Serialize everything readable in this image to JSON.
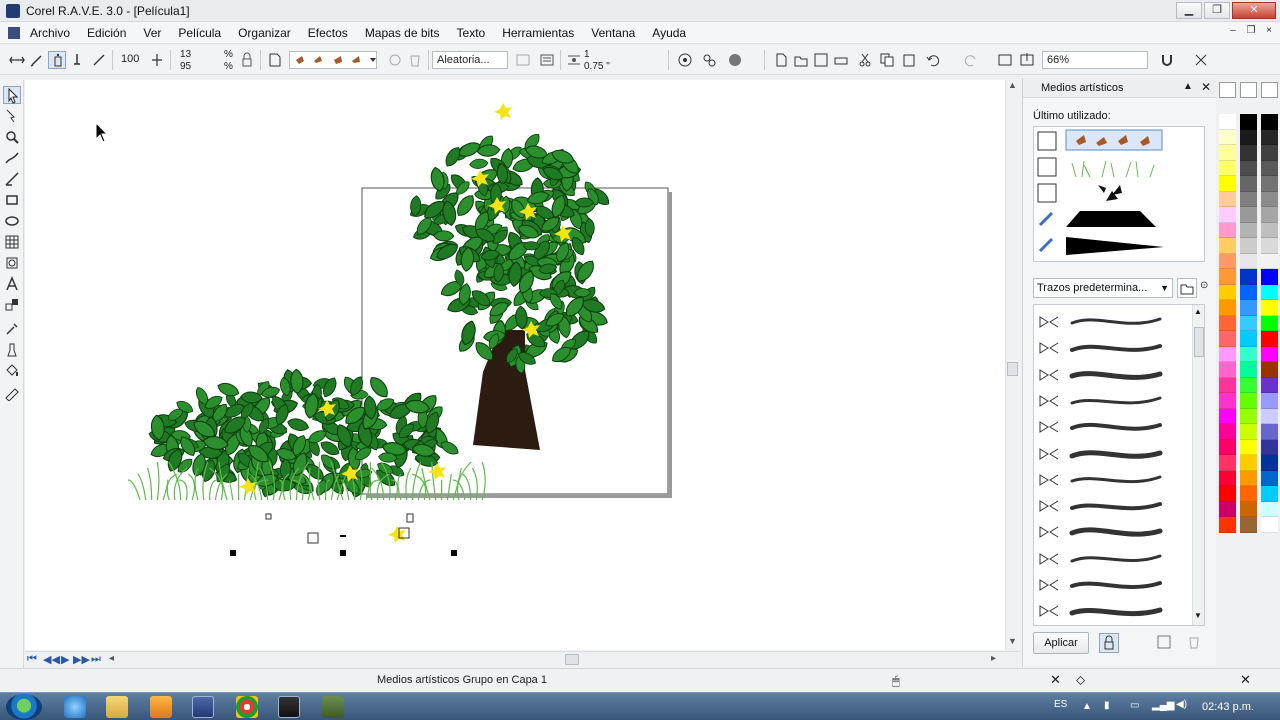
{
  "window": {
    "title": "Corel R.A.V.E. 3.0 - [Película1]",
    "btn_min": "▁",
    "btn_max": "❐",
    "btn_close": "✕"
  },
  "menu": {
    "items": [
      "Archivo",
      "Edición",
      "Ver",
      "Película",
      "Organizar",
      "Efectos",
      "Mapas de bits",
      "Texto",
      "Herramientas",
      "Ventana",
      "Ayuda"
    ],
    "mdi_min": "–",
    "mdi_restore": "❐",
    "mdi_close": "×"
  },
  "property_bar": {
    "smoothing_value": "100",
    "size_top": "13",
    "size_bottom": "95",
    "percent_top": "%",
    "percent_bottom": "%",
    "spray_order": "Aleatoria...",
    "spacing_top": "1",
    "spacing_bottom": "0.75 \"",
    "zoom_level": "66%"
  },
  "docker": {
    "title": "Medios artísticos",
    "recent_label": "Último utilizado:",
    "stroke_category": "Trazos predetermina...",
    "apply_label": "Aplicar",
    "stroke_count": 12
  },
  "status": {
    "selection_text": "Medios artísticos Grupo en Capa 1"
  },
  "taskbar": {
    "language": "ES",
    "clock": "02:43 p.m."
  },
  "palettes": {
    "col1": [
      "#ffffff",
      "#ffffcc",
      "#ffff99",
      "#ffff66",
      "#ffff00",
      "#ffcc99",
      "#ffccff",
      "#ff99cc",
      "#ffcc66",
      "#ff9966",
      "#ff9933",
      "#ffcc00",
      "#ff9900",
      "#ff6633",
      "#ff6666",
      "#ff99ff",
      "#ff66cc",
      "#ff3399",
      "#ff33cc",
      "#ff00ff",
      "#ff0099",
      "#ff0066",
      "#ff3366",
      "#ff0033",
      "#ff0000",
      "#cc0066",
      "#ff3300"
    ],
    "col2": [
      "#000000",
      "#1a1a1a",
      "#333333",
      "#4d4d4d",
      "#666666",
      "#808080",
      "#999999",
      "#b3b3b3",
      "#cccccc",
      "#e6e6e6",
      "#0033cc",
      "#0066ff",
      "#3399ff",
      "#33ccff",
      "#00ccff",
      "#33ffcc",
      "#00ff99",
      "#33ff33",
      "#66ff00",
      "#99ff00",
      "#ccff00",
      "#ffff00",
      "#ffcc00",
      "#ff9900",
      "#ff6600",
      "#cc6600",
      "#996633"
    ],
    "col3": [
      "#000000",
      "#262626",
      "#404040",
      "#595959",
      "#737373",
      "#8c8c8c",
      "#a6a6a6",
      "#bfbfbf",
      "#d9d9d9",
      "#f2f2f2",
      "#0000ff",
      "#00ffff",
      "#ffff00",
      "#00ff00",
      "#ff0000",
      "#ff00ff",
      "#993300",
      "#6633cc",
      "#9999ff",
      "#ccccff",
      "#6666cc",
      "#333399",
      "#003399",
      "#0066cc",
      "#00ccff",
      "#ccffff",
      "#ffffff"
    ]
  }
}
